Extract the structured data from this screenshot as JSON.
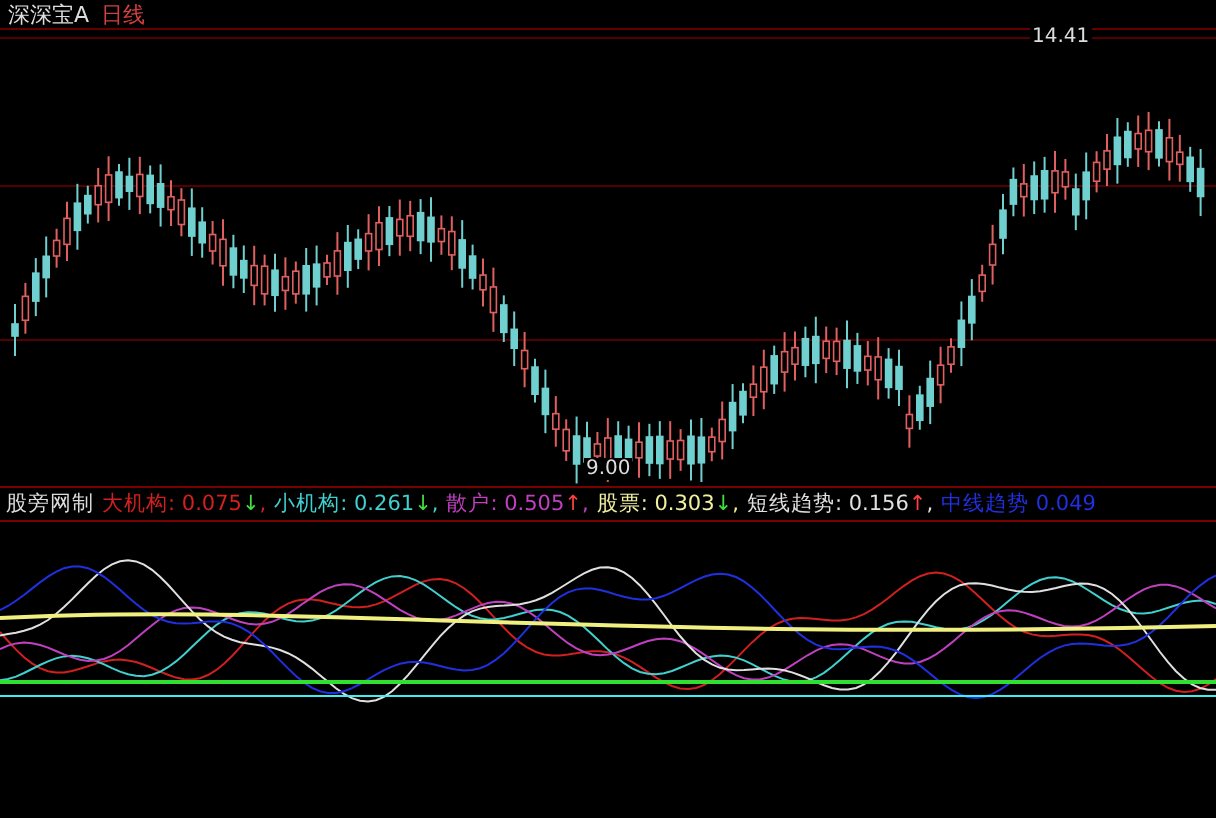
{
  "header": {
    "title": "深深宝A",
    "period": "日线"
  },
  "price_chart": {
    "high_label": "14.41",
    "low_label": "9.00"
  },
  "indicator": {
    "name": "股旁网制",
    "series": [
      {
        "label": "大机构:",
        "value": "0.075",
        "arrow": "↓",
        "separator": ",",
        "color": "#d02020"
      },
      {
        "label": "小机构:",
        "value": "0.261",
        "arrow": "↓",
        "separator": ",",
        "color": "#40d0d0"
      },
      {
        "label": "散户:",
        "value": "0.505",
        "arrow": "↑",
        "separator": ",",
        "color": "#c040c0"
      },
      {
        "label": "股票:",
        "value": "0.303",
        "arrow": "↓",
        "separator": ",",
        "color": "#f0f0a0"
      },
      {
        "label": "短线趋势:",
        "value": "0.156",
        "arrow": "↑",
        "separator": ",",
        "color": "#e0e0e0"
      },
      {
        "label": "中线趋势",
        "value": "0.049",
        "color": "#2030e0"
      }
    ]
  }
}
